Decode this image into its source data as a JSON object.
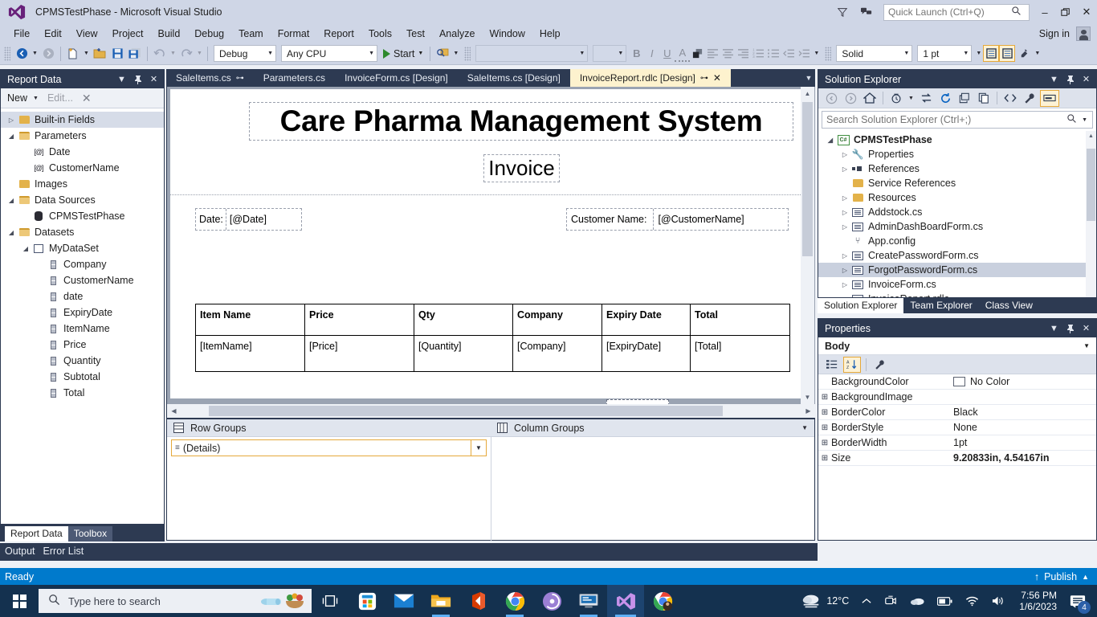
{
  "window": {
    "title": "CPMSTestPhase - Microsoft Visual Studio",
    "logo_icon": "visual-studio-logo",
    "feedback_icon": "feedback-icon",
    "filter_icon": "filter-icon",
    "quick_launch_placeholder": "Quick Launch (Ctrl+Q)",
    "quick_launch_value": "",
    "search_icon": "search-icon",
    "minimize_label": "–",
    "restore_label": "❐",
    "close_label": "✕",
    "sign_in_label": "Sign in"
  },
  "menu": {
    "items": [
      {
        "label": "File"
      },
      {
        "label": "Edit"
      },
      {
        "label": "View"
      },
      {
        "label": "Project"
      },
      {
        "label": "Build"
      },
      {
        "label": "Debug"
      },
      {
        "label": "Team"
      },
      {
        "label": "Format"
      },
      {
        "label": "Report"
      },
      {
        "label": "Tools"
      },
      {
        "label": "Test"
      },
      {
        "label": "Analyze"
      },
      {
        "label": "Window"
      },
      {
        "label": "Help"
      }
    ]
  },
  "toolbar": {
    "nav_back_icon": "navigate-back-icon",
    "nav_forward_icon": "navigate-forward-icon",
    "new_item_icon": "new-item-icon",
    "open_file_icon": "open-file-icon",
    "save_icon": "save-icon",
    "save_all_icon": "save-all-icon",
    "undo_icon": "undo-icon",
    "redo_icon": "redo-icon",
    "config_value": "Debug",
    "platform_value": "Any CPU",
    "start_label": "Start",
    "start_icon": "play-icon",
    "find_icon": "find-in-files-icon",
    "font_family_value": "",
    "font_size_value": "",
    "bold_label": "B",
    "italic_label": "I",
    "underline_label": "U",
    "font_color_label": "A",
    "fill_color_icon": "fill-color-icon",
    "align_left_icon": "align-left-icon",
    "align_center_icon": "align-center-icon",
    "align_right_icon": "align-right-icon",
    "numbered_list_icon": "numbered-list-icon",
    "bullet_list_icon": "bullet-list-icon",
    "decrease_indent_icon": "decrease-indent-icon",
    "increase_indent_icon": "increase-indent-icon",
    "border_style_value": "Solid",
    "border_width_value": "1 pt",
    "border_outline_icon": "border-outline-icon",
    "border_all_icon": "border-all-icon",
    "border_color_icon": "border-color-icon"
  },
  "report_data": {
    "title": "Report Data",
    "dropdown_icon": "chevron-down-icon",
    "pin_icon": "pin-icon",
    "close_icon": "close-icon",
    "new_label": "New",
    "edit_label": "Edit...",
    "delete_icon": "delete-icon",
    "tree": [
      {
        "label": "Built-in Fields",
        "icon": "folder-icon",
        "indent": 0,
        "expander": "collapsed",
        "selected": true
      },
      {
        "label": "Parameters",
        "icon": "folder-open-icon",
        "indent": 0,
        "expander": "expanded",
        "selected": false
      },
      {
        "label": "Date",
        "icon": "parameter-icon",
        "indent": 1,
        "expander": "none",
        "selected": false
      },
      {
        "label": "CustomerName",
        "icon": "parameter-icon",
        "indent": 1,
        "expander": "none",
        "selected": false
      },
      {
        "label": "Images",
        "icon": "folder-icon",
        "indent": 0,
        "expander": "none",
        "selected": false
      },
      {
        "label": "Data Sources",
        "icon": "folder-open-icon",
        "indent": 0,
        "expander": "expanded",
        "selected": false
      },
      {
        "label": "CPMSTestPhase",
        "icon": "database-icon",
        "indent": 1,
        "expander": "none",
        "selected": false
      },
      {
        "label": "Datasets",
        "icon": "folder-open-icon",
        "indent": 0,
        "expander": "expanded",
        "selected": false
      },
      {
        "label": "MyDataSet",
        "icon": "dataset-icon",
        "indent": 1,
        "expander": "expanded",
        "selected": false
      },
      {
        "label": "Company",
        "icon": "field-icon",
        "indent": 2,
        "expander": "none",
        "selected": false
      },
      {
        "label": "CustomerName",
        "icon": "field-icon",
        "indent": 2,
        "expander": "none",
        "selected": false
      },
      {
        "label": "date",
        "icon": "field-icon",
        "indent": 2,
        "expander": "none",
        "selected": false
      },
      {
        "label": "ExpiryDate",
        "icon": "field-icon",
        "indent": 2,
        "expander": "none",
        "selected": false
      },
      {
        "label": "ItemName",
        "icon": "field-icon",
        "indent": 2,
        "expander": "none",
        "selected": false
      },
      {
        "label": "Price",
        "icon": "field-icon",
        "indent": 2,
        "expander": "none",
        "selected": false
      },
      {
        "label": "Quantity",
        "icon": "field-icon",
        "indent": 2,
        "expander": "none",
        "selected": false
      },
      {
        "label": "Subtotal",
        "icon": "field-icon",
        "indent": 2,
        "expander": "none",
        "selected": false
      },
      {
        "label": "Total",
        "icon": "field-icon",
        "indent": 2,
        "expander": "none",
        "selected": false
      }
    ],
    "tabs": [
      {
        "label": "Report Data",
        "active": true
      },
      {
        "label": "Toolbox",
        "active": false
      }
    ]
  },
  "document_tabs": [
    {
      "label": "SaleItems.cs",
      "active": false,
      "pinned": true
    },
    {
      "label": "Parameters.cs",
      "active": false,
      "pinned": false
    },
    {
      "label": "InvoiceForm.cs [Design]",
      "active": false,
      "pinned": false
    },
    {
      "label": "SaleItems.cs [Design]",
      "active": false,
      "pinned": false
    },
    {
      "label": "InvoiceReport.rdlc [Design]",
      "active": true,
      "pinned": true
    }
  ],
  "designer": {
    "report_title": "Care Pharma Management System",
    "report_subtitle": "Invoice",
    "date_label": "Date:",
    "date_value": "[@Date]",
    "customer_label": "Customer Name:",
    "customer_value": "[@CustomerName]",
    "table": {
      "headers": [
        "Item Name",
        "Price",
        "Qty",
        "Company",
        "Expiry Date",
        "Total"
      ],
      "rows": [
        [
          "[ItemName]",
          "[Price]",
          "[Quantity]",
          "[Company]",
          "[ExpiryDate]",
          "[Total]"
        ]
      ]
    }
  },
  "groups_pane": {
    "row_groups_label": "Row Groups",
    "row_groups_icon": "row-groups-icon",
    "column_groups_label": "Column Groups",
    "column_groups_icon": "column-groups-icon",
    "menu_icon": "chevron-down-icon",
    "details_label": "(Details)",
    "details_caret_icon": "chevron-down-icon"
  },
  "solution_explorer": {
    "title": "Solution Explorer",
    "dropdown_icon": "chevron-down-icon",
    "pin_icon": "pin-icon",
    "close_icon": "close-icon",
    "toolbar_icons": [
      "back-icon",
      "forward-icon",
      "home-icon",
      "pending-changes-icon",
      "sync-with-active-document-icon",
      "refresh-icon",
      "collapse-all-icon",
      "show-all-files-icon",
      "view-code-icon",
      "properties-icon",
      "preview-selected-items-icon"
    ],
    "search_placeholder": "Search Solution Explorer (Ctrl+;)",
    "search_value": "",
    "search_icon": "search-icon",
    "tree": [
      {
        "label": "CPMSTestPhase",
        "icon": "csharp-project-icon",
        "indent": 0,
        "expander": "expanded",
        "bold": true,
        "selected": false
      },
      {
        "label": "Properties",
        "icon": "properties-icon",
        "indent": 1,
        "expander": "collapsed",
        "bold": false,
        "selected": false
      },
      {
        "label": "References",
        "icon": "references-icon",
        "indent": 1,
        "expander": "collapsed",
        "bold": false,
        "selected": false
      },
      {
        "label": "Service References",
        "icon": "folder-icon",
        "indent": 1,
        "expander": "none",
        "bold": false,
        "selected": false
      },
      {
        "label": "Resources",
        "icon": "folder-icon",
        "indent": 1,
        "expander": "collapsed",
        "bold": false,
        "selected": false
      },
      {
        "label": "Addstock.cs",
        "icon": "form-file-icon",
        "indent": 1,
        "expander": "collapsed",
        "bold": false,
        "selected": false
      },
      {
        "label": "AdminDashBoardForm.cs",
        "icon": "form-file-icon",
        "indent": 1,
        "expander": "collapsed",
        "bold": false,
        "selected": false
      },
      {
        "label": "App.config",
        "icon": "config-file-icon",
        "indent": 1,
        "expander": "none",
        "bold": false,
        "selected": false
      },
      {
        "label": "CreatePasswordForm.cs",
        "icon": "form-file-icon",
        "indent": 1,
        "expander": "collapsed",
        "bold": false,
        "selected": false
      },
      {
        "label": "ForgotPasswordForm.cs",
        "icon": "form-file-icon",
        "indent": 1,
        "expander": "collapsed",
        "bold": false,
        "selected": true
      },
      {
        "label": "InvoiceForm.cs",
        "icon": "form-file-icon",
        "indent": 1,
        "expander": "collapsed",
        "bold": false,
        "selected": false
      },
      {
        "label": "InvoiceReport.rdlc",
        "icon": "report-file-icon",
        "indent": 1,
        "expander": "none",
        "bold": false,
        "selected": false
      }
    ],
    "tabs": [
      {
        "label": "Solution Explorer",
        "active": true
      },
      {
        "label": "Team Explorer",
        "active": false
      },
      {
        "label": "Class View",
        "active": false
      }
    ]
  },
  "properties": {
    "title": "Properties",
    "dropdown_icon": "chevron-down-icon",
    "pin_icon": "pin-icon",
    "close_icon": "close-icon",
    "object_name": "Body",
    "object_caret_icon": "chevron-down-icon",
    "categorized_icon": "categorized-view-icon",
    "alphabetical_icon": "alphabetical-sort-icon",
    "property_pages_icon": "property-pages-icon",
    "rows": [
      {
        "name": "BackgroundColor",
        "value": "No Color",
        "expander": false,
        "swatch": "#ffffff",
        "bold": false
      },
      {
        "name": "BackgroundImage",
        "value": "",
        "expander": true,
        "swatch": null,
        "bold": false
      },
      {
        "name": "BorderColor",
        "value": "Black",
        "expander": true,
        "swatch": null,
        "bold": false
      },
      {
        "name": "BorderStyle",
        "value": "None",
        "expander": true,
        "swatch": null,
        "bold": false
      },
      {
        "name": "BorderWidth",
        "value": "1pt",
        "expander": true,
        "swatch": null,
        "bold": false
      },
      {
        "name": "Size",
        "value": "9.20833in, 4.54167in",
        "expander": true,
        "swatch": null,
        "bold": true
      }
    ]
  },
  "bottom_tabs": [
    {
      "label": "Output"
    },
    {
      "label": "Error List"
    }
  ],
  "status_bar": {
    "ready_label": "Ready",
    "publish_label": "Publish",
    "publish_up_icon": "arrow-up-icon",
    "publish_caret_icon": "chevron-up-icon",
    "accent_color": "#007acc"
  },
  "taskbar": {
    "start_icon": "windows-start-icon",
    "search_placeholder": "Type here to search",
    "search_icon": "search-icon",
    "task_view_icon": "task-view-icon",
    "pinned": [
      {
        "icon": "microsoft-store-icon"
      },
      {
        "icon": "mail-icon"
      },
      {
        "icon": "file-explorer-icon"
      },
      {
        "icon": "office-icon"
      },
      {
        "icon": "google-chrome-icon"
      },
      {
        "icon": "bittorrent-icon"
      },
      {
        "icon": "remote-desktop-icon"
      },
      {
        "icon": "visual-studio-icon",
        "active": true
      },
      {
        "icon": "chrome-profile-icon"
      }
    ],
    "tray": {
      "weather_icon": "cloud-fog-icon",
      "weather_text": "12°C",
      "show_hidden_icon": "chevron-up-icon",
      "meet_now_icon": "meet-now-icon",
      "onedrive_icon": "onedrive-icon",
      "battery_icon": "battery-icon",
      "network_icon": "wifi-icon",
      "volume_icon": "speaker-icon",
      "time": "7:56 PM",
      "date": "1/6/2023",
      "notifications_icon": "action-center-icon",
      "notifications_count": "4"
    }
  }
}
